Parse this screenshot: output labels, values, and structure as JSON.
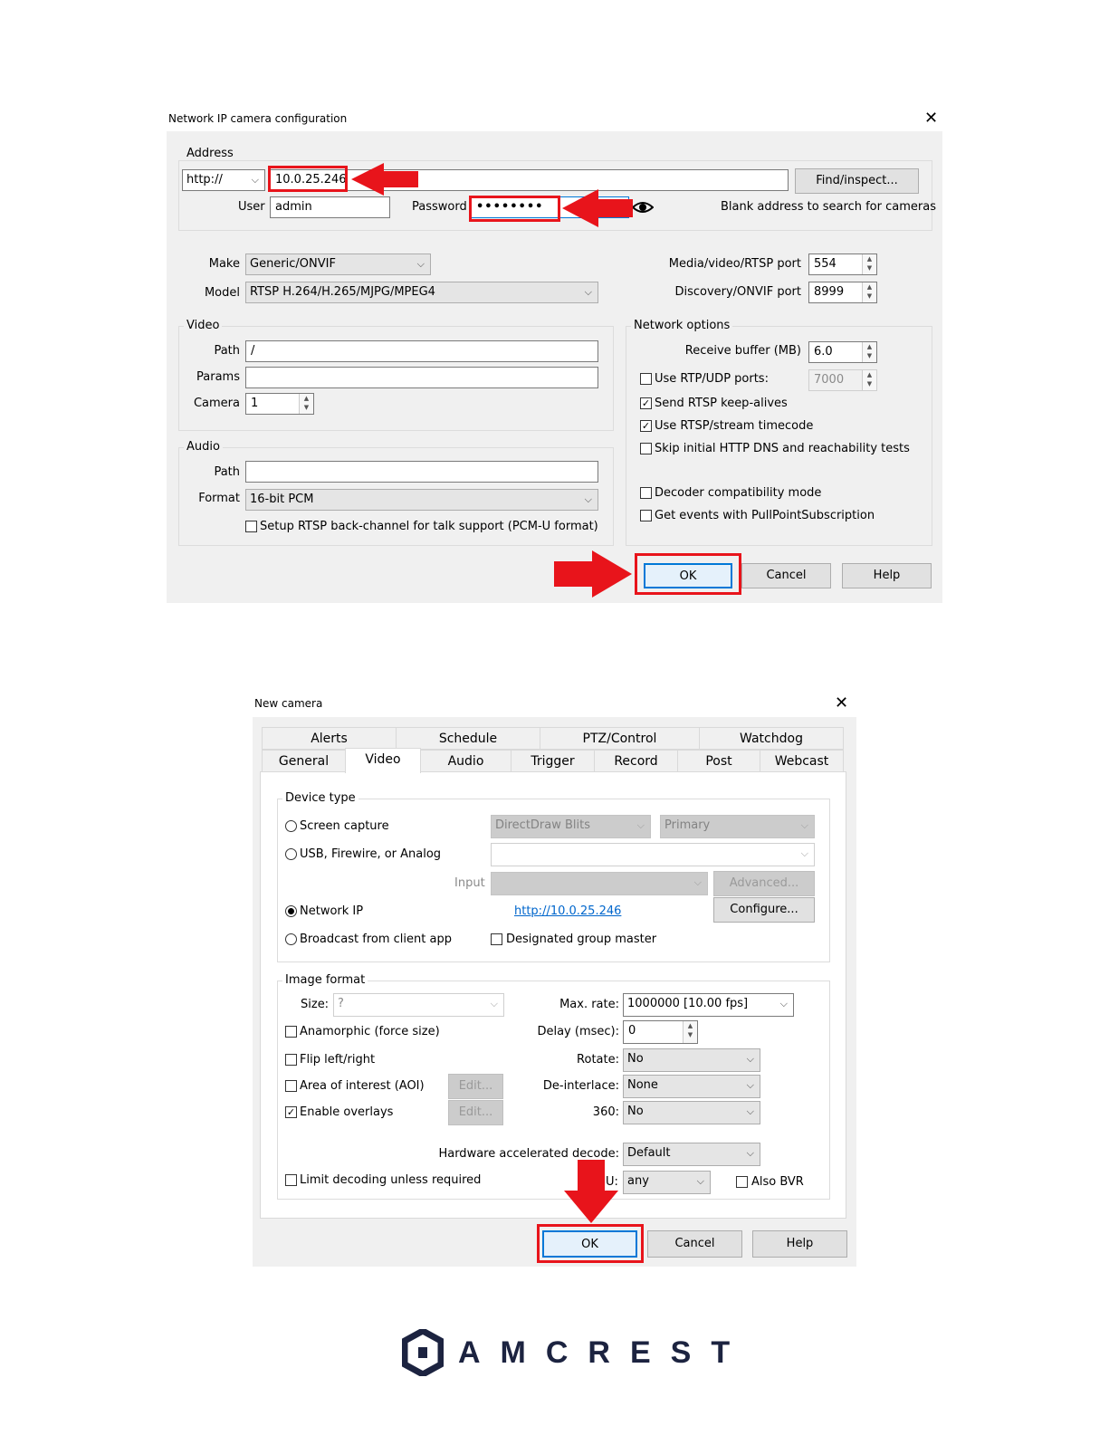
{
  "dialog1": {
    "title": "Network IP camera configuration",
    "address_group": "Address",
    "protocol": "http://",
    "address_value": "10.0.25.246",
    "find_button": "Find/inspect...",
    "user_label": "User",
    "user_value": "admin",
    "password_label": "Password",
    "password_value": "••••••••",
    "blank_hint": "Blank address to search for cameras",
    "make_label": "Make",
    "make_value": "Generic/ONVIF",
    "model_label": "Model",
    "model_value": "RTSP H.264/H.265/MJPG/MPEG4",
    "media_port_label": "Media/video/RTSP port",
    "media_port_value": "554",
    "onvif_port_label": "Discovery/ONVIF port",
    "onvif_port_value": "8999",
    "video_group": "Video",
    "video_path_label": "Path",
    "video_path_value": "/",
    "params_label": "Params",
    "params_value": "",
    "camera_label": "Camera",
    "camera_value": "1",
    "audio_group": "Audio",
    "audio_path_label": "Path",
    "audio_path_value": "",
    "format_label": "Format",
    "format_value": "16-bit PCM",
    "backchannel_label": "Setup RTSP back-channel for talk support (PCM-U format)",
    "network_group": "Network options",
    "receive_buffer_label": "Receive buffer (MB)",
    "receive_buffer_value": "6.0",
    "rtp_udp_label": "Use RTP/UDP ports:",
    "rtp_udp_value": "7000",
    "keepalive_label": "Send RTSP keep-alives",
    "timecode_label": "Use RTSP/stream timecode",
    "skip_dns_label": "Skip initial HTTP DNS and reachability tests",
    "decoder_compat_label": "Decoder compatibility mode",
    "pullpoint_label": "Get events with PullPointSubscription",
    "ok": "OK",
    "cancel": "Cancel",
    "help": "Help"
  },
  "dialog2": {
    "title": "New camera",
    "tabs_top": [
      "Alerts",
      "Schedule",
      "PTZ/Control",
      "Watchdog"
    ],
    "tabs_bottom": [
      "General",
      "Video",
      "Audio",
      "Trigger",
      "Record",
      "Post",
      "Webcast"
    ],
    "device_type_group": "Device type",
    "screen_capture": "Screen capture",
    "directdraw": "DirectDraw Blits",
    "primary": "Primary",
    "usb": "USB, Firewire, or Analog",
    "input_label": "Input",
    "advanced": "Advanced...",
    "network_ip": "Network IP",
    "network_ip_link": "http://10.0.25.246",
    "configure": "Configure...",
    "broadcast": "Broadcast from client app",
    "group_master": "Designated group master",
    "image_format_group": "Image format",
    "size_label": "Size:",
    "size_value": "?",
    "max_rate_label": "Max. rate:",
    "max_rate_value": "1000000 [10.00 fps]",
    "anamorphic": "Anamorphic (force size)",
    "delay_label": "Delay (msec):",
    "delay_value": "0",
    "flip": "Flip left/right",
    "rotate_label": "Rotate:",
    "rotate_value": "No",
    "aoi": "Area of interest (AOI)",
    "edit": "Edit...",
    "deinterlace_label": "De-interlace:",
    "deinterlace_value": "None",
    "overlays": "Enable overlays",
    "label_360": "360:",
    "value_360": "No",
    "hw_decode_label": "Hardware accelerated decode:",
    "hw_decode_value": "Default",
    "limit_decoding": "Limit decoding unless required",
    "gpu_label_fragment": "U:",
    "gpu_value": "any",
    "also_bvr": "Also BVR",
    "ok": "OK",
    "cancel": "Cancel",
    "help": "Help"
  },
  "brand": {
    "name": "AMCREST"
  },
  "colors": {
    "highlight_red": "#e8141b",
    "panel_bg": "#f0f0f0",
    "accent_blue": "#0078d7"
  }
}
